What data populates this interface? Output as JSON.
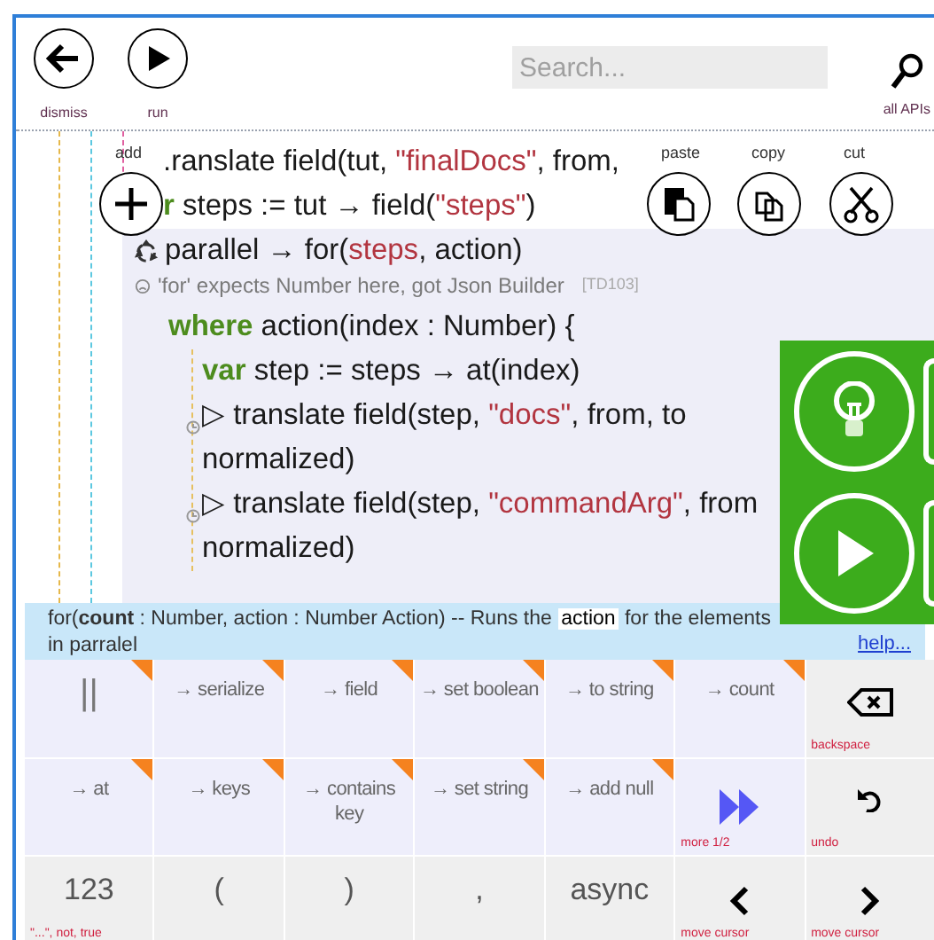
{
  "toolbar": {
    "buttons": [
      {
        "label": "dismiss",
        "kind": "back"
      },
      {
        "label": "run",
        "kind": "play"
      }
    ],
    "search": {
      "placeholder": "Search..."
    },
    "search_button": {
      "label": "all APIs"
    }
  },
  "clipboard": [
    {
      "label": "add",
      "kind": "add"
    },
    {
      "label": "paste",
      "kind": "paste"
    },
    {
      "label": "copy",
      "kind": "copy"
    },
    {
      "label": "cut",
      "kind": "cut"
    }
  ],
  "editor": {
    "statements": [
      {
        "kind": "plain",
        "tokens": [
          {
            "text": ".ranslate field(tut, ",
            "kind": "plain"
          },
          {
            "text": "\"finalDocs\"",
            "kind": "string"
          },
          {
            "text": ", from,",
            "kind": "plain"
          }
        ]
      },
      {
        "kind": "plain",
        "tokens": [
          {
            "text": "r",
            "kind": "keyword"
          },
          {
            "text": " steps := tut → field(",
            "kind": "plain"
          },
          {
            "text": "\"steps\"",
            "kind": "string"
          },
          {
            "text": ")",
            "kind": "plain"
          }
        ]
      },
      {
        "kind": "parallel",
        "tokens": [
          {
            "text": "parallel → for(",
            "kind": "plain"
          },
          {
            "text": "steps",
            "kind": "string"
          },
          {
            "text": ",  action)",
            "kind": "plain"
          }
        ],
        "error": {
          "message": "'for' expects Number here, got Json Builder",
          "code": "[TD103]"
        },
        "children": [
          {
            "kind": "plain",
            "tokens": [
              {
                "text": "where",
                "kind": "keyword"
              },
              {
                "text": " action(index : Number) {",
                "kind": "plain"
              }
            ],
            "children": [
              {
                "kind": "plain",
                "tokens": [
                  {
                    "text": "var",
                    "kind": "keyword"
                  },
                  {
                    "text": " step := steps → at(index)",
                    "kind": "plain"
                  }
                ]
              },
              {
                "kind": "timed",
                "tokens": [
                  {
                    "text": "▷ translate field(step, ",
                    "kind": "plain"
                  },
                  {
                    "text": "\"docs\"",
                    "kind": "string"
                  },
                  {
                    "text": ", from, to\nnormalized)",
                    "kind": "plain"
                  }
                ]
              },
              {
                "kind": "timed",
                "tokens": [
                  {
                    "text": "▷ translate field(step, ",
                    "kind": "plain"
                  },
                  {
                    "text": "\"commandArg\"",
                    "kind": "string"
                  },
                  {
                    "text": ", from\nnormalized)",
                    "kind": "plain"
                  }
                ]
              }
            ]
          }
        ]
      }
    ]
  },
  "help": {
    "segments": [
      {
        "text": "for(**count** : Number, action : Number Action) -- Runs the ",
        "kind": "plain"
      },
      {
        "text": "action",
        "kind": "highlight"
      },
      {
        "text": " for the elements\nin parralel",
        "kind": "plain"
      }
    ],
    "link": "help..."
  },
  "keyboard": {
    "rows": [
      [
        {
          "label": "||",
          "kind": "api",
          "flagged": true
        },
        {
          "label": "→ serialize",
          "kind": "api",
          "flagged": true
        },
        {
          "label": "→ field",
          "kind": "api",
          "flagged": true
        },
        {
          "label": "→ set boolean",
          "kind": "api",
          "flagged": true
        },
        {
          "label": "→ to string",
          "kind": "api",
          "flagged": true
        },
        {
          "label": "→ count",
          "kind": "api",
          "flagged": true
        },
        {
          "hint": "backspace",
          "kind": "backspace",
          "flagged": false
        }
      ],
      [
        {
          "label": "→ at",
          "kind": "api",
          "flagged": true
        },
        {
          "label": "→ keys",
          "kind": "api",
          "flagged": true
        },
        {
          "label": "→ contains key",
          "kind": "api",
          "flagged": true
        },
        {
          "label": "→ set string",
          "kind": "api",
          "flagged": true
        },
        {
          "label": "→ add null",
          "kind": "api",
          "flagged": true
        },
        {
          "hint": "more 1/2",
          "kind": "more",
          "flagged": false
        },
        {
          "hint": "undo",
          "kind": "undo",
          "flagged": false
        }
      ],
      [
        {
          "label": "123",
          "hint": "\"...\", not, true",
          "kind": "symbol",
          "flagged": false
        },
        {
          "label": "(",
          "kind": "symbol",
          "flagged": false
        },
        {
          "label": ")",
          "kind": "symbol",
          "flagged": false
        },
        {
          "label": ",",
          "kind": "symbol",
          "flagged": false
        },
        {
          "label": "async",
          "kind": "symbol",
          "flagged": false
        },
        {
          "hint": "move cursor",
          "kind": "left",
          "flagged": false
        },
        {
          "hint": "move cursor",
          "kind": "right",
          "flagged": false
        }
      ]
    ]
  }
}
